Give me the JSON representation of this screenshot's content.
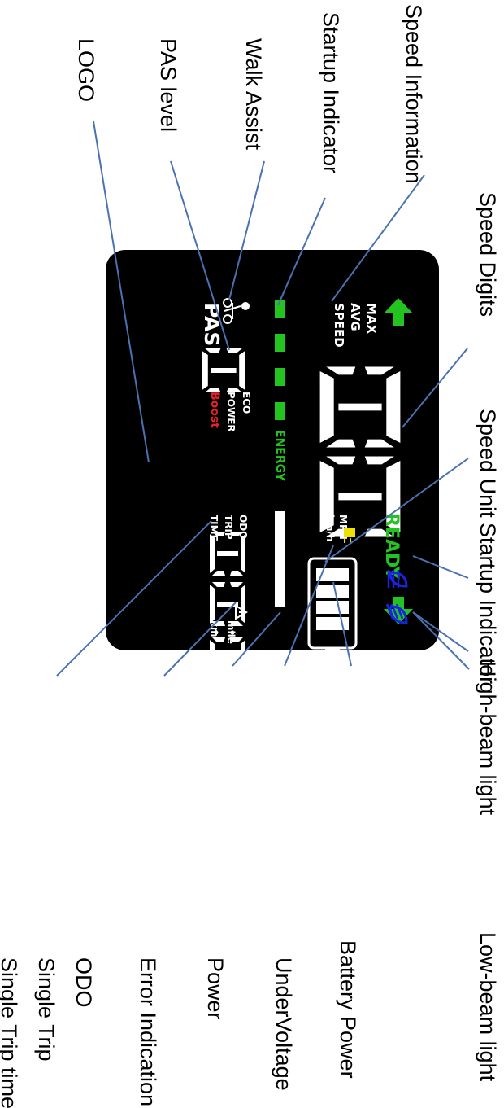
{
  "callouts": {
    "speed_information": "Speed Information",
    "startup_indicator_top": "Startup Indicator",
    "walk_assist": "Walk Assist",
    "pas_level": "PAS level",
    "logo": "LOGO",
    "speed_digits": "Speed Digits",
    "speed_unit": "Speed Unit",
    "startup_indicator_right": "Startup Indicator",
    "high_beam": "High-beam light",
    "low_beam": "Low-beam light",
    "battery_power": "Battery Power",
    "undervoltage": "UnderVoltage",
    "power": "Power",
    "error_indication": "Error Indication",
    "odo": "ODO",
    "single_trip": "Single Trip",
    "single_trip_time": "Single Trip time"
  },
  "lcd": {
    "max": "MAX",
    "avg": "AVG",
    "speed": "SPEED",
    "mph": "MPH",
    "kmh": "km/h",
    "ready": "READY",
    "energy": "ENERGY",
    "pas": "PAS",
    "eco": "ECO",
    "power": "POWER",
    "boost": "Boost",
    "odo": "ODO",
    "trip": "TRIP",
    "time": "TIME",
    "mile": "mile",
    "km": "km"
  },
  "icons": {
    "up_arrow": "green-up-arrow-icon",
    "down_arrow": "green-down-arrow-icon",
    "high_beam": "high-beam-icon",
    "low_beam": "low-beam-icon",
    "walk_assist": "walking-bike-icon",
    "undervoltage": "undervoltage-plug-icon",
    "warning": "warning-triangle-icon",
    "battery": "battery-icon"
  },
  "colors": {
    "lcd_background": "#000000",
    "green_indicator": "#23c41f",
    "blue_light": "#1a24e0",
    "boost_red": "#e8202a",
    "undervoltage_yellow": "#f0e000",
    "leader_line": "#4a72b0"
  }
}
